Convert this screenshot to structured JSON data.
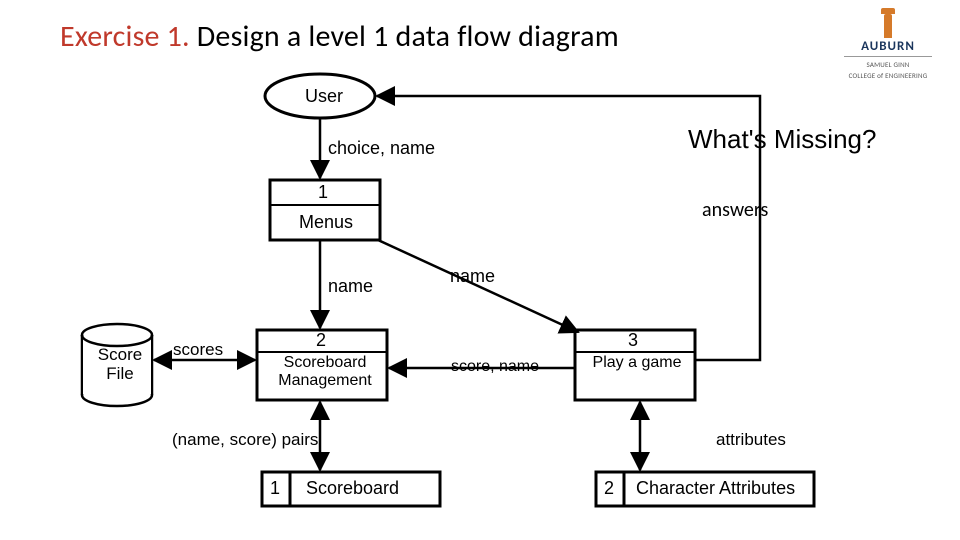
{
  "header": {
    "accent": "Exercise 1.",
    "rest": " Design a level 1 data flow diagram"
  },
  "logo": {
    "university": "AUBURN",
    "college1": "SAMUEL GINN",
    "college2": "COLLEGE of ENGINEERING"
  },
  "callout": "What's Missing?",
  "entities": {
    "user": "User"
  },
  "processes": {
    "p1": {
      "num": "1",
      "name": "Menus"
    },
    "p2": {
      "num": "2",
      "name": "Scoreboard Management"
    },
    "p3": {
      "num": "3",
      "name": "Play a game"
    }
  },
  "datastores": {
    "d_score_file": "Score File",
    "d1": {
      "num": "1",
      "name": "Scoreboard"
    },
    "d2": {
      "num": "2",
      "name": "Character Attributes"
    }
  },
  "flows": {
    "choice_name": "choice, name",
    "answers": "answers",
    "name1": "name",
    "name2": "name",
    "score_name": "score, name",
    "scores": "scores",
    "pairs": "(name, score) pairs",
    "attributes": "attributes"
  }
}
